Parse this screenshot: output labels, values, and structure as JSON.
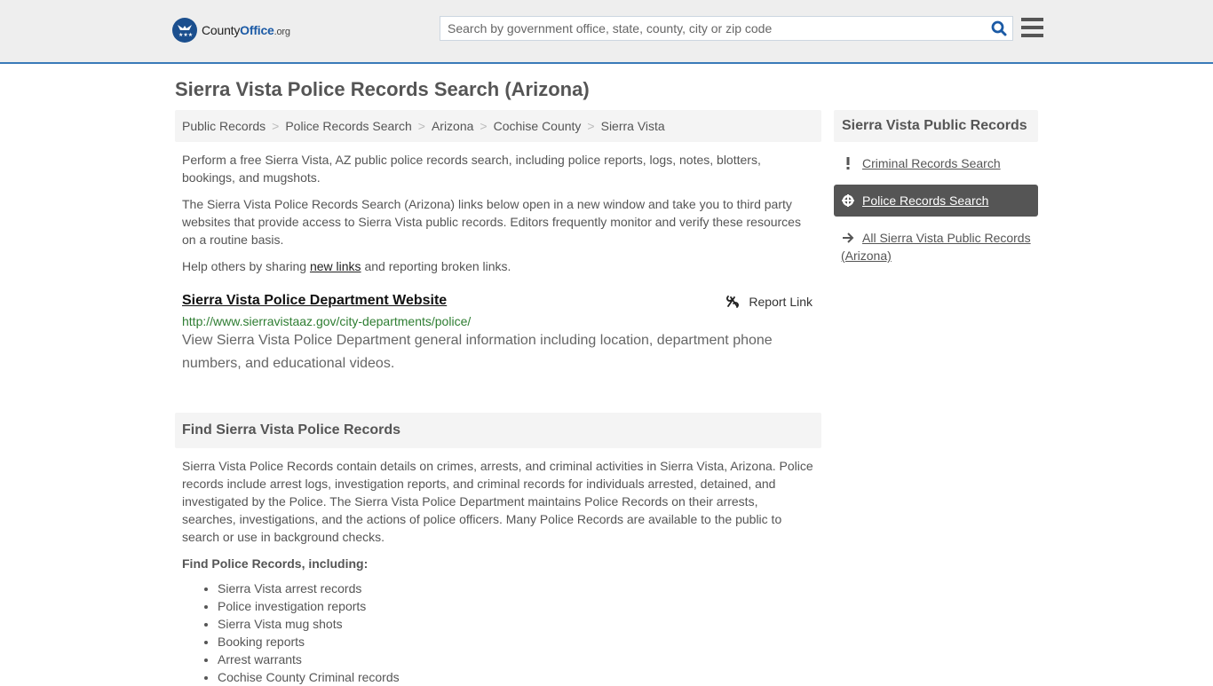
{
  "header": {
    "logo": {
      "county": "County",
      "office": "Office",
      "org": ".org"
    },
    "search_placeholder": "Search by government office, state, county, city or zip code",
    "search_value": ""
  },
  "page_title": "Sierra Vista Police Records Search (Arizona)",
  "breadcrumb": [
    "Public Records",
    "Police Records Search",
    "Arizona",
    "Cochise County",
    "Sierra Vista"
  ],
  "intro": {
    "p1": "Perform a free Sierra Vista, AZ public police records search, including police reports, logs, notes, blotters, bookings, and mugshots.",
    "p2": "The Sierra Vista Police Records Search (Arizona) links below open in a new window and take you to third party websites that provide access to Sierra Vista public records. Editors frequently monitor and verify these resources on a routine basis.",
    "p3_before": "Help others by sharing ",
    "p3_link": "new links",
    "p3_after": " and reporting broken links."
  },
  "result": {
    "title": "Sierra Vista Police Department Website",
    "report_label": "Report Link",
    "url": "http://www.sierravistaaz.gov/city-departments/police/",
    "description": "View Sierra Vista Police Department general information including location, department phone numbers, and educational videos."
  },
  "find_section": {
    "heading": "Find Sierra Vista Police Records",
    "body": "Sierra Vista Police Records contain details on crimes, arrests, and criminal activities in Sierra Vista, Arizona. Police records include arrest logs, investigation reports, and criminal records for individuals arrested, detained, and investigated by the Police. The Sierra Vista Police Department maintains Police Records on their arrests, searches, investigations, and the actions of police officers. Many Police Records are available to the public to search or use in background checks.",
    "sub_heading": "Find Police Records, including:",
    "items": [
      "Sierra Vista arrest records",
      "Police investigation reports",
      "Sierra Vista mug shots",
      "Booking reports",
      "Arrest warrants",
      "Cochise County Criminal records"
    ]
  },
  "sidebar": {
    "heading": "Sierra Vista Public Records",
    "items": [
      {
        "label": "Criminal Records Search",
        "icon": "exclamation-icon",
        "active": false
      },
      {
        "label": "Police Records Search",
        "icon": "crosshair-icon",
        "active": true
      },
      {
        "label": "All Sierra Vista Public Records (Arizona)",
        "icon": "arrow-right-icon",
        "active": false
      }
    ]
  },
  "colors": {
    "accent_blue": "#3a7ab8",
    "logo_blue": "#1b5aa5",
    "url_green": "#2e7d32",
    "active_bg": "#555555"
  }
}
